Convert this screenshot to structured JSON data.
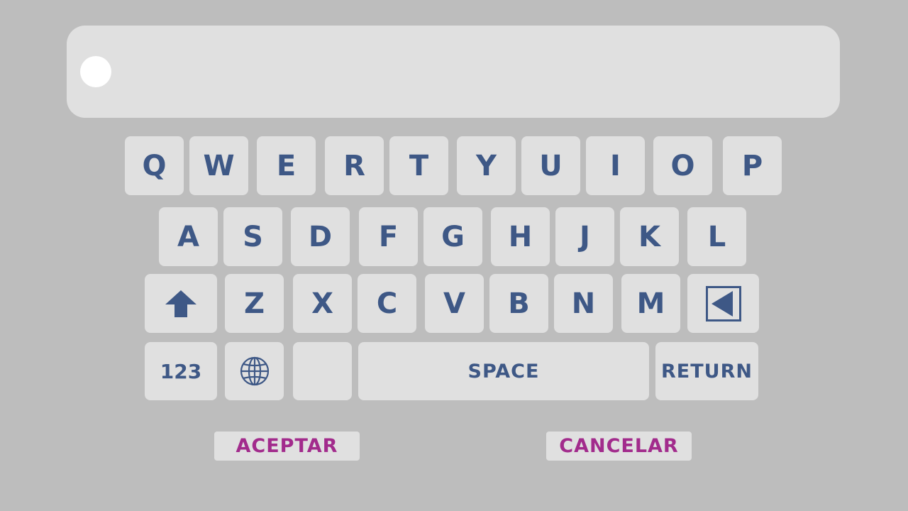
{
  "input": {
    "value": ""
  },
  "keyboard": {
    "row1": [
      "Q",
      "W",
      "E",
      "R",
      "T",
      "Y",
      "U",
      "I",
      "O",
      "P"
    ],
    "row2": [
      "A",
      "S",
      "D",
      "F",
      "G",
      "H",
      "J",
      "K",
      "L"
    ],
    "row3": [
      "Z",
      "X",
      "C",
      "V",
      "B",
      "N",
      "M"
    ],
    "numbers_label": "123",
    "space_label": "SPACE",
    "return_label": "RETURN",
    "shift_icon": "arrow-up-icon",
    "globe_icon": "globe-icon",
    "backspace_icon": "backspace-icon"
  },
  "actions": {
    "accept_label": "ACEPTAR",
    "cancel_label": "CANCELAR"
  },
  "colors": {
    "background": "#bdbdbd",
    "key": "#e0e0e0",
    "key_text": "#3e5886",
    "action_text": "#a22b8c",
    "cursor": "#ffffff"
  }
}
